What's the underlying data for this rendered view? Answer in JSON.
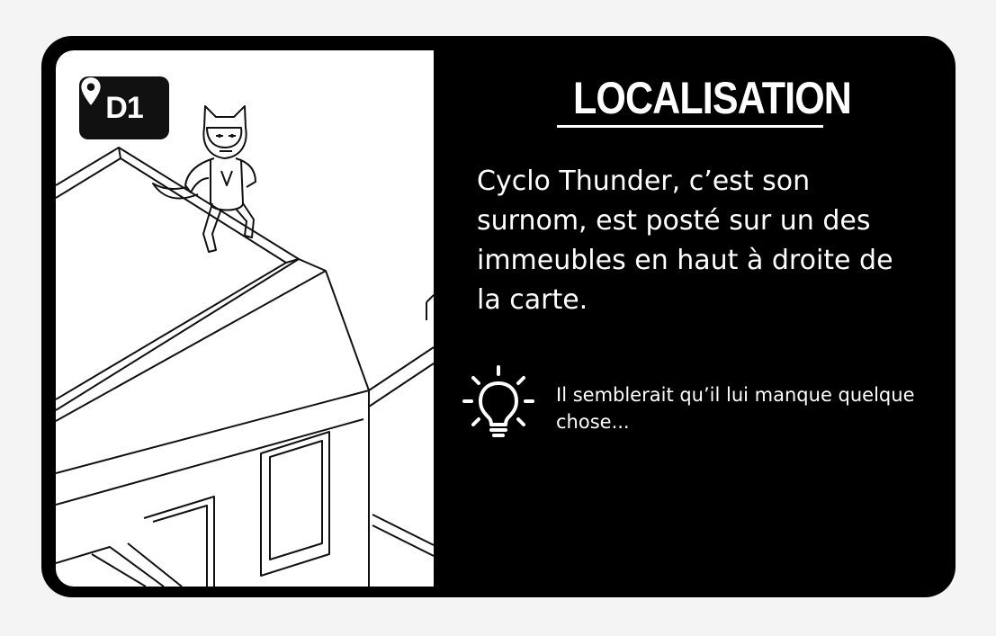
{
  "card": {
    "location_badge": {
      "icon": "map-pin-icon",
      "code": "D1"
    },
    "title": "LOCALISATION",
    "description": "Cyclo Thunder, c’est son surnom, est posté sur un des immeubles en haut à droite de la carte.",
    "hint": {
      "icon": "light-bulb-icon",
      "text": "Il semblerait qu’il lui manque quelque chose..."
    },
    "colors": {
      "card_background": "#000000",
      "text": "#ffffff",
      "illustration_background": "#ffffff"
    }
  }
}
